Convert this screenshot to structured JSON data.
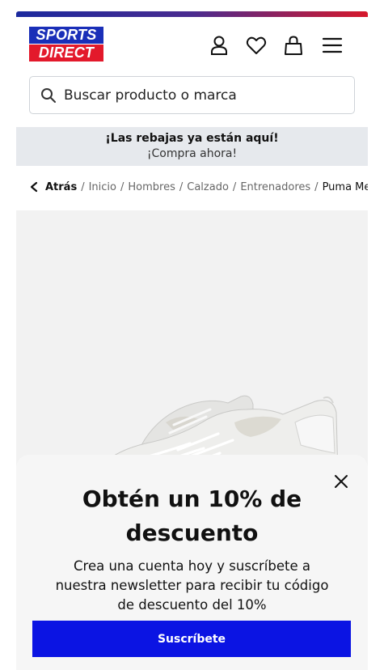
{
  "brand": {
    "logo_top": "SPORTS",
    "logo_bottom": "DIRECT",
    "colors": {
      "blue": "#1a2fb8",
      "red": "#e3192b"
    }
  },
  "header": {
    "icons": [
      "account-icon",
      "wishlist-heart-icon",
      "bag-icon",
      "menu-icon"
    ]
  },
  "search": {
    "placeholder": "Buscar producto o marca",
    "icon": "search-icon"
  },
  "promo": {
    "title": "¡Las rebajas ya están aquí!",
    "subtitle": "¡Compra ahora!",
    "background": "#e6e9ed"
  },
  "breadcrumb": {
    "back_label": "Atrás",
    "items": [
      "Inicio",
      "Hombres",
      "Calzado",
      "Entrenadores"
    ],
    "current": "Puma Men's"
  },
  "modal": {
    "title_line1": "Obtén un 10% de",
    "title_line2": "descuento",
    "body_line1": "Crea una cuenta hoy y suscríbete a",
    "body_line2": "nuestra newsletter para recibir tu código",
    "body_line3": "de descuento del 10%",
    "button_label": "Suscríbete",
    "button_color": "#0b14e3"
  }
}
